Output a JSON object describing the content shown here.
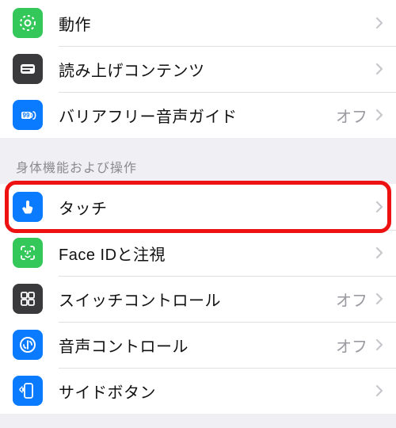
{
  "section1": {
    "items": [
      {
        "label": "動作"
      },
      {
        "label": "読み上げコンテンツ"
      },
      {
        "label": "バリアフリー音声ガイド",
        "value": "オフ"
      }
    ]
  },
  "section2": {
    "header": "身体機能および操作",
    "items": [
      {
        "label": "タッチ"
      },
      {
        "label": "Face IDと注視"
      },
      {
        "label": "スイッチコントロール",
        "value": "オフ"
      },
      {
        "label": "音声コントロール",
        "value": "オフ"
      },
      {
        "label": "サイドボタン"
      }
    ]
  }
}
